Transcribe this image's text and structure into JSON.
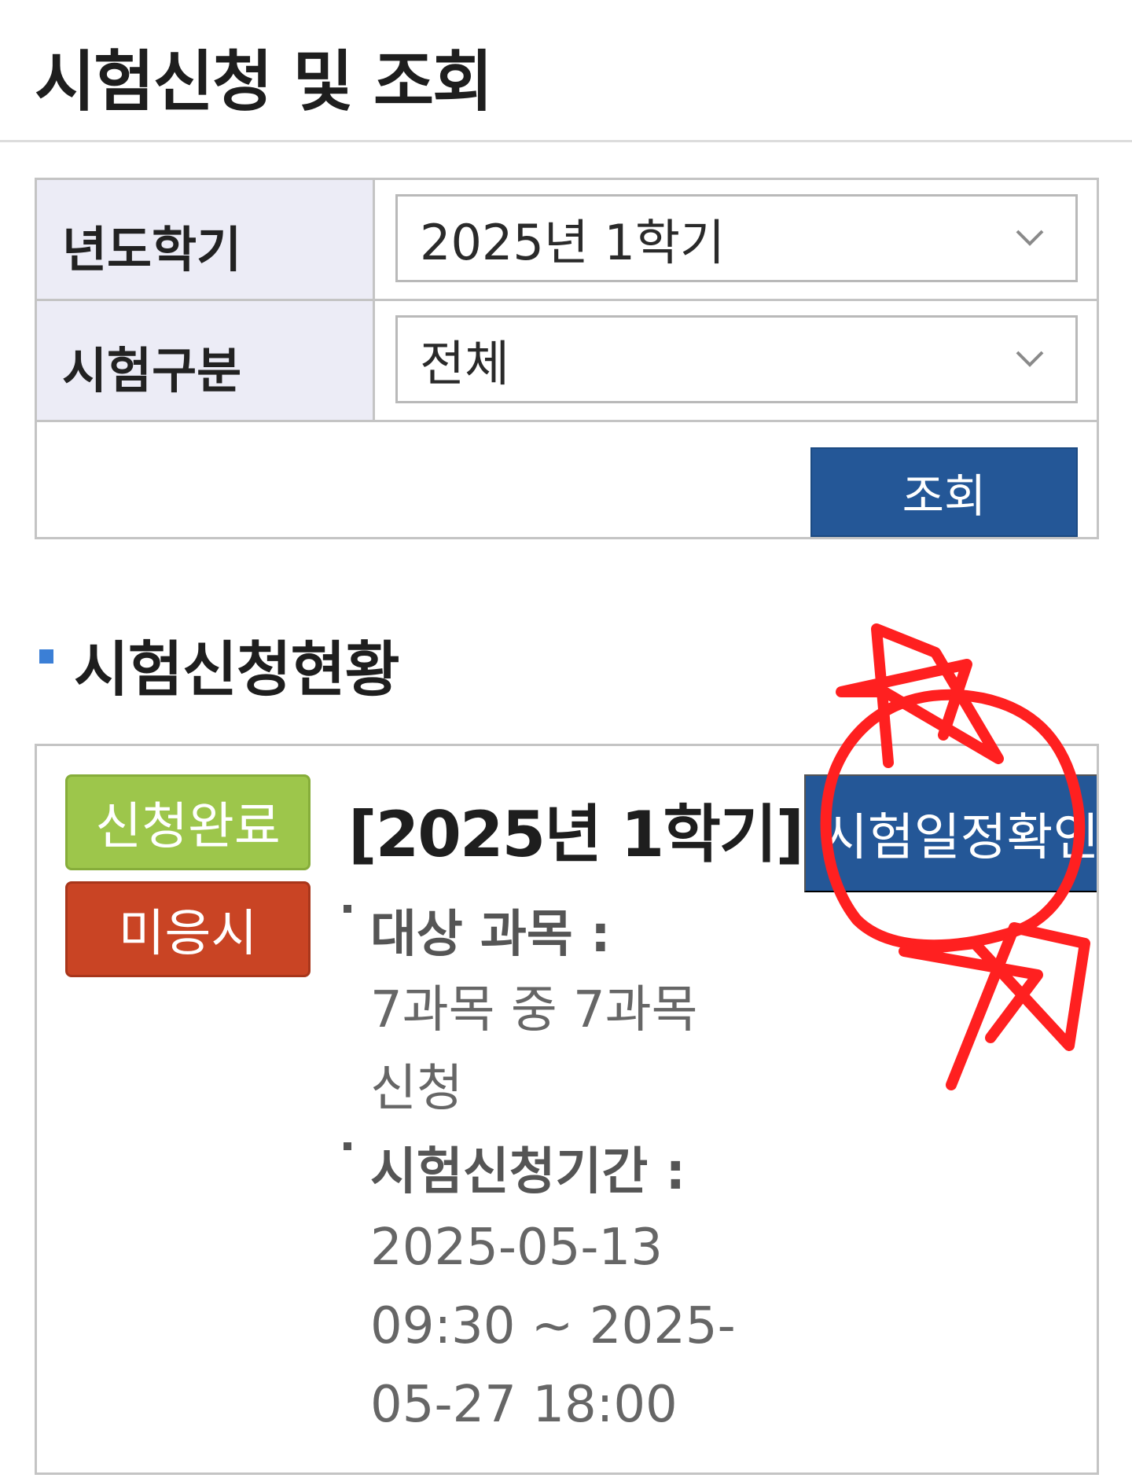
{
  "header": {
    "title": "시험신청 및 조회"
  },
  "search_form": {
    "term_label": "년도학기",
    "term_value": "2025년 1학기",
    "exam_type_label": "시험구분",
    "exam_type_value": "전체",
    "search_button": "조회"
  },
  "status_section": {
    "title": "시험신청현황"
  },
  "exam_card": {
    "badges": {
      "applied": "신청완료",
      "absent": "미응시"
    },
    "title": "[2025년 1학기]",
    "schedule_button": "시험일정확인",
    "subjects_label": "대상 과목 :",
    "subjects_value": "7과목 중 7과목 신청",
    "period_label": "시험신청기간 :",
    "period_value": "2025-05-13 09:30 ~ 2025-05-27 18:00"
  },
  "colors": {
    "primary_blue": "#245797",
    "badge_green": "#9dc64b",
    "badge_red": "#c94424",
    "label_bg": "#ececf6",
    "annotation_red": "#ff2020"
  },
  "icons": {
    "dropdown": "chevron-down-icon",
    "section": "square-bullet-icon"
  }
}
